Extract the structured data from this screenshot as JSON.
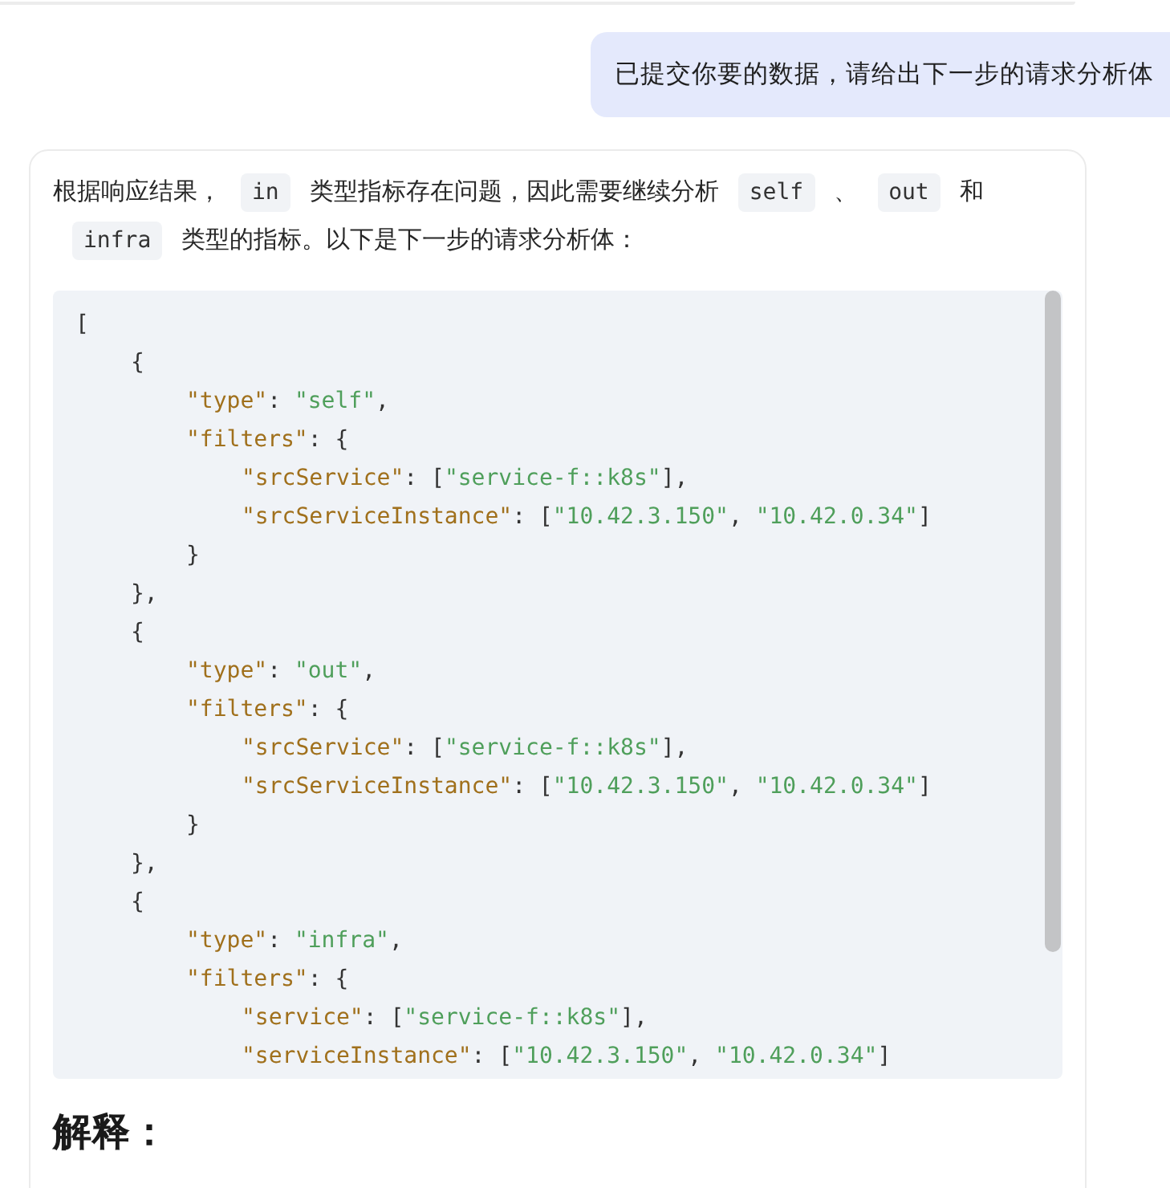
{
  "user_message": {
    "text": "已提交你要的数据，请给出下一步的请求分析体"
  },
  "assistant_message": {
    "paragraph": [
      {
        "kind": "text",
        "text": "根据响应结果，"
      },
      {
        "kind": "code",
        "text": "in"
      },
      {
        "kind": "text",
        "text": "类型指标存在问题，因此需要继续分析"
      },
      {
        "kind": "code",
        "text": "self"
      },
      {
        "kind": "text",
        "text": "、"
      },
      {
        "kind": "code",
        "text": "out"
      },
      {
        "kind": "text",
        "text": "和"
      },
      {
        "kind": "code",
        "text": "infra"
      },
      {
        "kind": "text",
        "text": "类型的指标。以下是下一步的请求分析体："
      }
    ],
    "code_block": {
      "lines": [
        {
          "tokens": [
            {
              "kind": "punct",
              "text": "["
            }
          ],
          "children": [
            {
              "tokens": [
                {
                  "kind": "punct",
                  "text": "{"
                }
              ],
              "children": [
                {
                  "tokens": [
                    {
                      "kind": "key",
                      "text": "\"type\""
                    },
                    {
                      "kind": "punct",
                      "text": ": "
                    },
                    {
                      "kind": "string",
                      "text": "\"self\""
                    },
                    {
                      "kind": "punct",
                      "text": ","
                    }
                  ]
                },
                {
                  "tokens": [
                    {
                      "kind": "key",
                      "text": "\"filters\""
                    },
                    {
                      "kind": "punct",
                      "text": ": {"
                    }
                  ],
                  "children": [
                    {
                      "tokens": [
                        {
                          "kind": "key",
                          "text": "\"srcService\""
                        },
                        {
                          "kind": "punct",
                          "text": ": ["
                        },
                        {
                          "kind": "string",
                          "text": "\"service-f::k8s\""
                        },
                        {
                          "kind": "punct",
                          "text": "],"
                        }
                      ]
                    },
                    {
                      "tokens": [
                        {
                          "kind": "key",
                          "text": "\"srcServiceInstance\""
                        },
                        {
                          "kind": "punct",
                          "text": ": ["
                        },
                        {
                          "kind": "string",
                          "text": "\"10.42.3.150\""
                        },
                        {
                          "kind": "punct",
                          "text": ", "
                        },
                        {
                          "kind": "string",
                          "text": "\"10.42.0.34\""
                        },
                        {
                          "kind": "punct",
                          "text": "]"
                        }
                      ]
                    }
                  ]
                },
                {
                  "tokens": [
                    {
                      "kind": "punct",
                      "text": "}"
                    }
                  ]
                }
              ]
            },
            {
              "tokens": [
                {
                  "kind": "punct",
                  "text": "},"
                }
              ]
            },
            {
              "tokens": [
                {
                  "kind": "punct",
                  "text": "{"
                }
              ],
              "children": [
                {
                  "tokens": [
                    {
                      "kind": "key",
                      "text": "\"type\""
                    },
                    {
                      "kind": "punct",
                      "text": ": "
                    },
                    {
                      "kind": "string",
                      "text": "\"out\""
                    },
                    {
                      "kind": "punct",
                      "text": ","
                    }
                  ]
                },
                {
                  "tokens": [
                    {
                      "kind": "key",
                      "text": "\"filters\""
                    },
                    {
                      "kind": "punct",
                      "text": ": {"
                    }
                  ],
                  "children": [
                    {
                      "tokens": [
                        {
                          "kind": "key",
                          "text": "\"srcService\""
                        },
                        {
                          "kind": "punct",
                          "text": ": ["
                        },
                        {
                          "kind": "string",
                          "text": "\"service-f::k8s\""
                        },
                        {
                          "kind": "punct",
                          "text": "],"
                        }
                      ]
                    },
                    {
                      "tokens": [
                        {
                          "kind": "key",
                          "text": "\"srcServiceInstance\""
                        },
                        {
                          "kind": "punct",
                          "text": ": ["
                        },
                        {
                          "kind": "string",
                          "text": "\"10.42.3.150\""
                        },
                        {
                          "kind": "punct",
                          "text": ", "
                        },
                        {
                          "kind": "string",
                          "text": "\"10.42.0.34\""
                        },
                        {
                          "kind": "punct",
                          "text": "]"
                        }
                      ]
                    }
                  ]
                },
                {
                  "tokens": [
                    {
                      "kind": "punct",
                      "text": "}"
                    }
                  ]
                }
              ]
            },
            {
              "tokens": [
                {
                  "kind": "punct",
                  "text": "},"
                }
              ]
            },
            {
              "tokens": [
                {
                  "kind": "punct",
                  "text": "{"
                }
              ],
              "children": [
                {
                  "tokens": [
                    {
                      "kind": "key",
                      "text": "\"type\""
                    },
                    {
                      "kind": "punct",
                      "text": ": "
                    },
                    {
                      "kind": "string",
                      "text": "\"infra\""
                    },
                    {
                      "kind": "punct",
                      "text": ","
                    }
                  ]
                },
                {
                  "tokens": [
                    {
                      "kind": "key",
                      "text": "\"filters\""
                    },
                    {
                      "kind": "punct",
                      "text": ": {"
                    }
                  ],
                  "children": [
                    {
                      "tokens": [
                        {
                          "kind": "key",
                          "text": "\"service\""
                        },
                        {
                          "kind": "punct",
                          "text": ": ["
                        },
                        {
                          "kind": "string",
                          "text": "\"service-f::k8s\""
                        },
                        {
                          "kind": "punct",
                          "text": "],"
                        }
                      ]
                    },
                    {
                      "tokens": [
                        {
                          "kind": "key",
                          "text": "\"serviceInstance\""
                        },
                        {
                          "kind": "punct",
                          "text": ": ["
                        },
                        {
                          "kind": "string",
                          "text": "\"10.42.3.150\""
                        },
                        {
                          "kind": "punct",
                          "text": ", "
                        },
                        {
                          "kind": "string",
                          "text": "\"10.42.0.34\""
                        },
                        {
                          "kind": "punct",
                          "text": "]"
                        }
                      ]
                    }
                  ]
                }
              ]
            }
          ]
        }
      ]
    },
    "heading": "解释："
  }
}
